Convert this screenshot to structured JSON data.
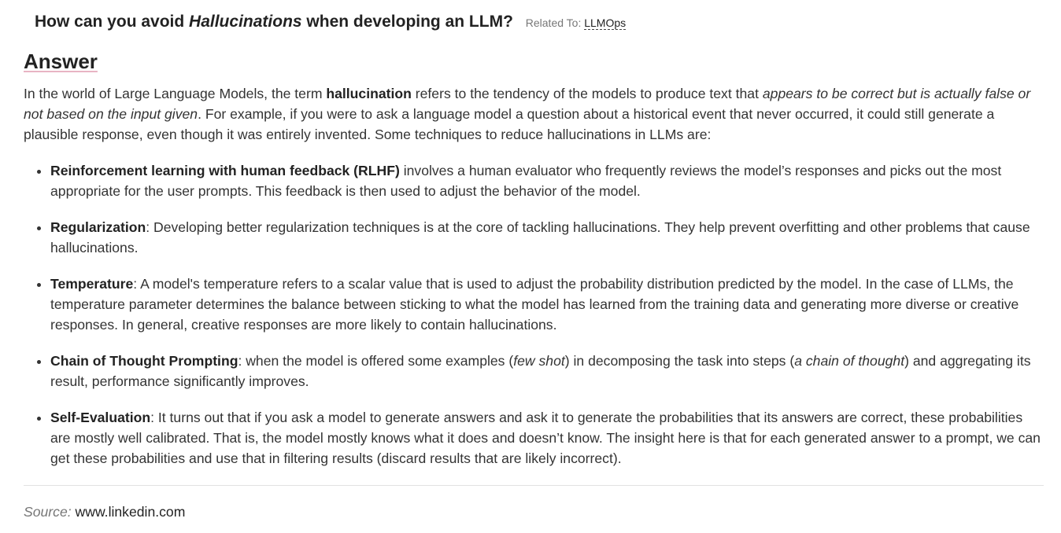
{
  "question": {
    "prefix": "How can you avoid ",
    "emphasis": "Hallucinations",
    "suffix": " when developing an LLM?",
    "related_label": "Related To: ",
    "related_link": "LLMOps"
  },
  "answer": {
    "heading": "Answer",
    "intro": {
      "part1": "In the world of Large Language Models, the term ",
      "bold": "hallucination",
      "part2": " refers to the tendency of the models to produce text that ",
      "italic": "appears to be correct but is actually false or not based on the input given",
      "part3": ". For example, if you were to ask a language model a question about a historical event that never occurred, it could still generate a plausible response, even though it was entirely invented. Some techniques to reduce hallucinations in LLMs are:"
    },
    "items": [
      {
        "term": "Reinforcement learning with human feedback (RLHF)",
        "text": " involves a human evaluator who frequently reviews the model’s responses and picks out the most appropriate for the user prompts. This feedback is then used to adjust the behavior of the model."
      },
      {
        "term": "Regularization",
        "text": ": Developing better regularization techniques is at the core of tackling hallucinations. They help prevent overfitting and other problems that cause hallucinations."
      },
      {
        "term": "Temperature",
        "text": ": A model's temperature refers to a scalar value that is used to adjust the probability distribution predicted by the model. In the case of LLMs, the temperature parameter determines the balance between sticking to what the model has learned from the training data and generating more diverse or creative responses. In general, creative responses are more likely to contain hallucinations."
      },
      {
        "term": "Chain of Thought Prompting",
        "text_a": ": when the model is offered some examples (",
        "italic_a": "few shot",
        "text_b": ") in decomposing the task into steps (",
        "italic_b": "a chain of thought",
        "text_c": ") and aggregating its result, performance significantly improves."
      },
      {
        "term": "Self-Evaluation",
        "text": ": It turns out that if you ask a model to generate answers and ask it to generate the probabilities that its answers are correct, these probabilities are mostly well calibrated. That is, the model mostly knows what it does and doesn’t know. The insight here is that for each generated answer to a prompt, we can get these probabilities and use that in filtering results (discard results that are likely incorrect)."
      }
    ]
  },
  "source": {
    "label": "Source:",
    "link": "www.linkedin.com"
  }
}
